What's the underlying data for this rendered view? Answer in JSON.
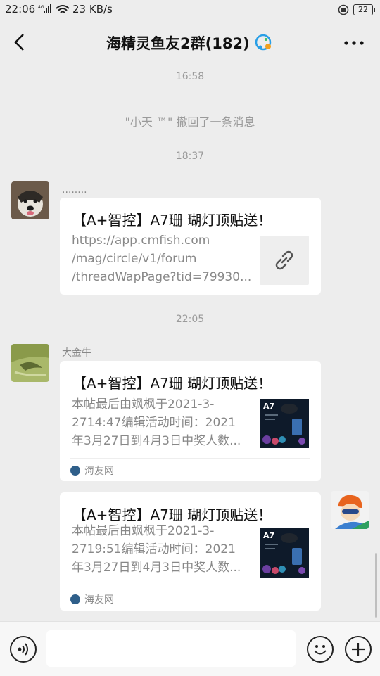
{
  "status_bar": {
    "time": "22:06",
    "network": "4G",
    "speed": "23 KB/s",
    "battery": "22"
  },
  "header": {
    "title": "海精灵鱼友2群(182)",
    "back_icon": "chevron-left-icon",
    "more_icon": "ellipsis-icon",
    "badge_icon": "group-chat-badge-icon"
  },
  "messages": {
    "t1": "16:58",
    "recall": "\"小天 ™\" 撤回了一条消息",
    "t2": "18:37",
    "msg1": {
      "sender": "........",
      "title": "【A+智控】A7珊 瑚灯顶贴送！",
      "url_line1": "https://app.cmfish.com",
      "url_line2": "/mag/circle/v1/forum",
      "url_line3": "/threadWapPage?tid=79930...",
      "icon": "link-icon"
    },
    "t3": "22:05",
    "msg2": {
      "sender": "大金牛",
      "title": "【A+智控】A7珊 瑚灯顶贴送！",
      "desc1": "本帖最后由飒枫于2021-3-",
      "desc2": "2714:47编辑活动时间：2021",
      "desc3": "年3月27日到4月3日中奖人数...",
      "source": "海友网",
      "thumb_label": "A7"
    },
    "msg3": {
      "title": "【A+智控】A7珊 瑚灯顶贴送！",
      "desc1": "本帖最后由飒枫于2021-3-",
      "desc2": "2719:51编辑活动时间：2021",
      "desc3": "年3月27日到4月3日中奖人数...",
      "source": "海友网",
      "thumb_label": "A7"
    }
  },
  "input_bar": {
    "voice_icon": "voice-input-icon",
    "emoji_icon": "emoji-icon",
    "plus_icon": "plus-icon"
  },
  "colors": {
    "background": "#ededed",
    "card": "#ffffff",
    "muted_text": "#9a9a9a"
  }
}
